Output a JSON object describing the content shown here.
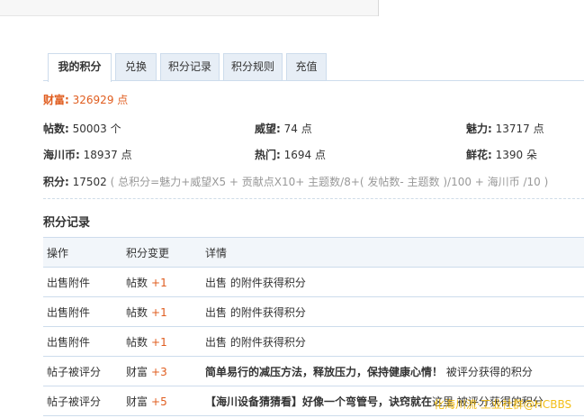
{
  "tabs": [
    {
      "label": "我的积分",
      "active": true
    },
    {
      "label": "兑换"
    },
    {
      "label": "积分记录"
    },
    {
      "label": "积分规则"
    },
    {
      "label": "充值"
    }
  ],
  "wealth": {
    "label": "财富:",
    "value": "326929 点"
  },
  "stats": {
    "posts": {
      "label": "帖数:",
      "value": "50003 个"
    },
    "prestige": {
      "label": "威望:",
      "value": "74 点"
    },
    "charm": {
      "label": "魅力:",
      "value": "13717 点"
    },
    "coin": {
      "label": "海川币:",
      "value": "18937 点"
    },
    "hot": {
      "label": "热门:",
      "value": "1694 点"
    },
    "flowers": {
      "label": "鲜花:",
      "value": "1390 朵"
    }
  },
  "formula": {
    "label": "积分:",
    "value": "17502",
    "note": "( 总积分=魅力+威望X5 + 贡献点X10+ 主题数/8+( 发帖数- 主题数 )/100 + 海川币 /10 )"
  },
  "section_title": "积分记录",
  "log_table": {
    "headers": [
      "操作",
      "积分变更",
      "详情"
    ],
    "rows": [
      {
        "action": "出售附件",
        "change_type": "帖数",
        "change": "+1",
        "detail": "出售 的附件获得积分"
      },
      {
        "action": "出售附件",
        "change_type": "帖数",
        "change": "+1",
        "detail": "出售 的附件获得积分"
      },
      {
        "action": "出售附件",
        "change_type": "帖数",
        "change": "+1",
        "detail": "出售 的附件获得积分"
      },
      {
        "action": "帖子被评分",
        "change_type": "财富",
        "change": "+3",
        "detail_bold": "简单易行的减压方法，释放压力，保持健康心情！",
        "detail": " 被评分获得的积分"
      },
      {
        "action": "帖子被评分",
        "change_type": "财富",
        "change": "+5",
        "detail_bold": "【海川设备猜猜看】好像一个弯管号，诀窍就在",
        "detail": "这里 被评分获得的积分"
      }
    ]
  },
  "watermark": "化海川流·工业社群@HCBBS"
}
